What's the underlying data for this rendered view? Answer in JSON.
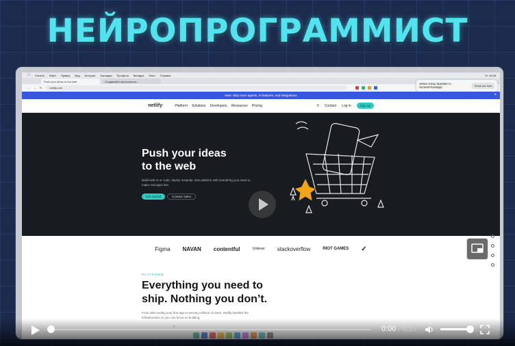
{
  "headline": "НЕЙРОПРОГРАММИСТ",
  "mac_menubar": {
    "items": [
      "Chrome",
      "Файл",
      "Правка",
      "Вид",
      "История",
      "Закладки",
      "Профили",
      "Вкладка",
      "Окно",
      "Справка"
    ],
    "right": "Пт 16:48"
  },
  "browser": {
    "tabs": [
      {
        "label": "Push your ideas to the web",
        "active": true
      },
      {
        "label": "Создавайте приложения...",
        "active": false
      }
    ],
    "address": "netlify.com"
  },
  "notification": {
    "text_line1": "Select Krisp Speaker in",
    "text_line2": "ScreenFlow/appl",
    "button": "Show me how"
  },
  "site": {
    "banner": "New: Ship more agents, AI features, and integrations",
    "logo": "netlify",
    "nav": [
      "Platform",
      "Solutions",
      "Developers",
      "Resources",
      "Pricing"
    ],
    "nav_right": [
      "Contact",
      "Log in"
    ],
    "signup": "Sign up",
    "hero_title_l1": "Push your ideas",
    "hero_title_l2": "to the web",
    "hero_sub": "Build with AI or code, deploy instantly. One platform with everything you need to make real apps live.",
    "hero_btn_primary": "Get started",
    "hero_btn_secondary": "Contact Sales",
    "logos": [
      "Figma",
      "NAVAN",
      "contentful",
      "Unilever",
      "stackoverflow",
      "RIOT GAMES",
      "Nike"
    ],
    "platform_label": "PLATFORM",
    "section_title_l1": "Everything you need to",
    "section_title_l2": "ship. Nothing you don’t.",
    "section_sub": "From vibe-coding your first app to serving millions of users, Netlify handles the infrastructure so you can focus on building."
  },
  "player": {
    "current_time": "0:00",
    "separator": "/",
    "duration": "6:57",
    "progress": 0.0,
    "volume": 0.85
  }
}
